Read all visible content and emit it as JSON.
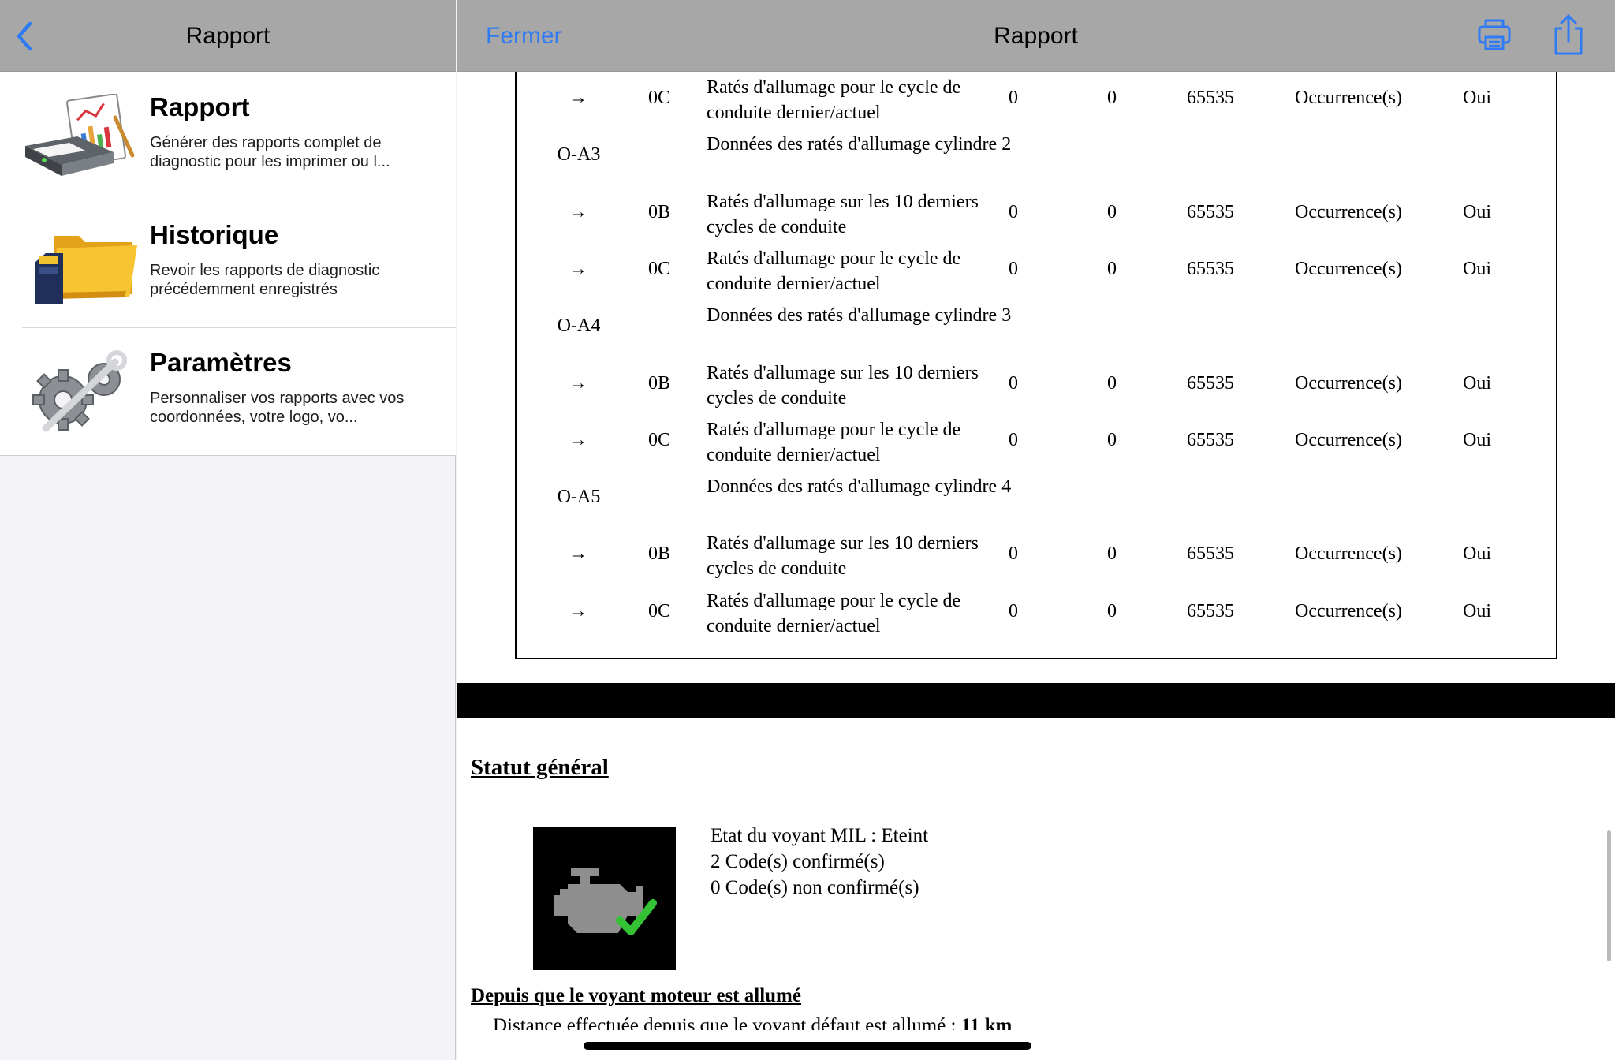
{
  "left_pane": {
    "title": "Rapport",
    "back_icon": "chevron-left-icon",
    "items": [
      {
        "title": "Rapport",
        "description": "Générer des rapports complet de diagnostic pour les imprimer ou l...",
        "icon": "printer-report-icon"
      },
      {
        "title": "Historique",
        "description": "Revoir les rapports de diagnostic précédemment enregistrés",
        "icon": "folder-sdcard-icon"
      },
      {
        "title": "Paramètres",
        "description": "Personnaliser vos rapports avec vos coordonnées, votre logo, vo...",
        "icon": "gears-wrench-icon"
      }
    ]
  },
  "right_pane": {
    "close_label": "Fermer",
    "title": "Rapport",
    "print_icon": "printer-icon",
    "share_icon": "share-icon",
    "accent_color": "#2f7bf5"
  },
  "table": {
    "rows": [
      {
        "type": "sub",
        "arrow": "→",
        "sub": "0C",
        "desc": "Ratés d'allumage pour le cycle de conduite dernier/actuel",
        "v1": "0",
        "v2": "0",
        "v3": "65535",
        "unit": "Occurrence(s)",
        "flag": "Oui"
      },
      {
        "type": "group",
        "code": "O-A3",
        "desc": "Données des ratés d'allumage cylindre 2"
      },
      {
        "type": "sub",
        "arrow": "→",
        "sub": "0B",
        "desc": "Ratés d'allumage sur les 10 derniers cycles de conduite",
        "v1": "0",
        "v2": "0",
        "v3": "65535",
        "unit": "Occurrence(s)",
        "flag": "Oui"
      },
      {
        "type": "sub",
        "arrow": "→",
        "sub": "0C",
        "desc": "Ratés d'allumage pour le cycle de conduite dernier/actuel",
        "v1": "0",
        "v2": "0",
        "v3": "65535",
        "unit": "Occurrence(s)",
        "flag": "Oui"
      },
      {
        "type": "group",
        "code": "O-A4",
        "desc": "Données des ratés d'allumage cylindre 3"
      },
      {
        "type": "sub",
        "arrow": "→",
        "sub": "0B",
        "desc": "Ratés d'allumage sur les 10 derniers cycles de conduite",
        "v1": "0",
        "v2": "0",
        "v3": "65535",
        "unit": "Occurrence(s)",
        "flag": "Oui"
      },
      {
        "type": "sub",
        "arrow": "→",
        "sub": "0C",
        "desc": "Ratés d'allumage pour le cycle de conduite dernier/actuel",
        "v1": "0",
        "v2": "0",
        "v3": "65535",
        "unit": "Occurrence(s)",
        "flag": "Oui"
      },
      {
        "type": "group",
        "code": "O-A5",
        "desc": "Données des ratés d'allumage cylindre 4"
      },
      {
        "type": "sub",
        "arrow": "→",
        "sub": "0B",
        "desc": "Ratés d'allumage sur les 10 derniers cycles de conduite",
        "v1": "0",
        "v2": "0",
        "v3": "65535",
        "unit": "Occurrence(s)",
        "flag": "Oui"
      },
      {
        "type": "sub",
        "arrow": "→",
        "sub": "0C",
        "desc": "Ratés d'allumage pour le cycle de conduite dernier/actuel",
        "v1": "0",
        "v2": "0",
        "v3": "65535",
        "unit": "Occurrence(s)",
        "flag": "Oui"
      }
    ]
  },
  "status": {
    "heading": "Statut général",
    "icon": "engine-check-icon",
    "lines": [
      "Etat du voyant MIL : Eteint",
      "2 Code(s) confirmé(s)",
      "0 Code(s) non confirmé(s)"
    ]
  },
  "since_mil": {
    "heading": "Depuis que le voyant moteur est allumé",
    "distance_label": "Distance effectuée depuis que le voyant défaut est allumé : ",
    "distance_value": "11 km"
  }
}
